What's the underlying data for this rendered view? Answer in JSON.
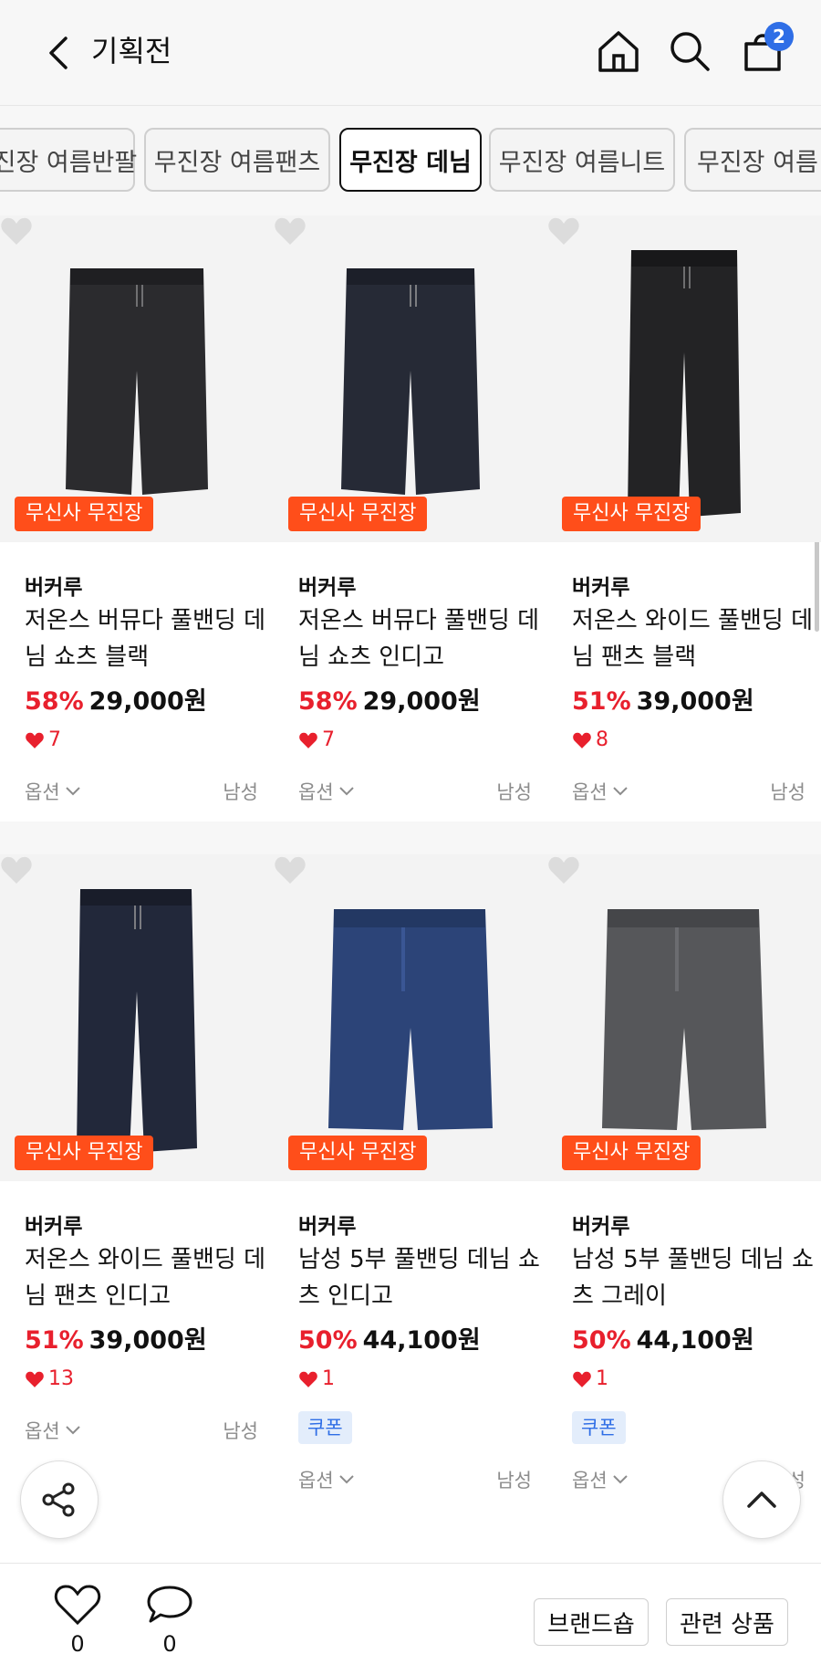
{
  "header": {
    "title": "기획전",
    "cart_count": "2",
    "icons": [
      "back-icon",
      "home-icon",
      "search-icon",
      "cart-icon"
    ]
  },
  "tabs": [
    {
      "label": "무진장 여름반팔",
      "active": false
    },
    {
      "label": "무진장 여름팬츠",
      "active": false
    },
    {
      "label": "무진장 데님",
      "active": true
    },
    {
      "label": "무진장 여름니트",
      "active": false
    },
    {
      "label": "무진장 여름",
      "active": false
    }
  ],
  "products": [
    {
      "tag": "무신사 무진장",
      "brand": "버커루",
      "name": "저온스 버뮤다 풀밴딩 데님 쇼츠 블랙",
      "discount": "58%",
      "price": "29,000원",
      "likes": "7",
      "coupon": "",
      "option": "옵션",
      "gender": "남성",
      "color": "#2b2b2e"
    },
    {
      "tag": "무신사 무진장",
      "brand": "버커루",
      "name": "저온스 버뮤다 풀밴딩 데님 쇼츠 인디고",
      "discount": "58%",
      "price": "29,000원",
      "likes": "7",
      "coupon": "",
      "option": "옵션",
      "gender": "남성",
      "color": "#262a36"
    },
    {
      "tag": "무신사 무진장",
      "brand": "버커루",
      "name": "저온스 와이드 풀밴딩 데님 팬츠 블랙",
      "discount": "51%",
      "price": "39,000원",
      "likes": "8",
      "coupon": "",
      "option": "옵션",
      "gender": "남성",
      "color": "#232325"
    },
    {
      "tag": "무신사 무진장",
      "brand": "버커루",
      "name": "저온스 와이드 풀밴딩 데님 팬츠 인디고",
      "discount": "51%",
      "price": "39,000원",
      "likes": "13",
      "coupon": "",
      "option": "옵션",
      "gender": "남성",
      "color": "#22283a"
    },
    {
      "tag": "무신사 무진장",
      "brand": "버커루",
      "name": "남성 5부 풀밴딩 데님 쇼츠 인디고",
      "discount": "50%",
      "price": "44,100원",
      "likes": "1",
      "coupon": "쿠폰",
      "option": "옵션",
      "gender": "남성",
      "color": "#2c4478"
    },
    {
      "tag": "무신사 무진장",
      "brand": "버커루",
      "name": "남성 5부 풀밴딩 데님 쇼츠 그레이",
      "discount": "50%",
      "price": "44,100원",
      "likes": "1",
      "coupon": "쿠폰",
      "option": "옵션",
      "gender": "남성",
      "color": "#56575a"
    }
  ],
  "bottom_bar": {
    "like_count": "0",
    "comment_count": "0",
    "brand_shop_label": "브랜드숍",
    "related_label": "관련 상품"
  },
  "colors": {
    "accent_red": "#e8202d",
    "tag_orange": "#ff4e1a",
    "badge_blue": "#2f6ee6"
  }
}
